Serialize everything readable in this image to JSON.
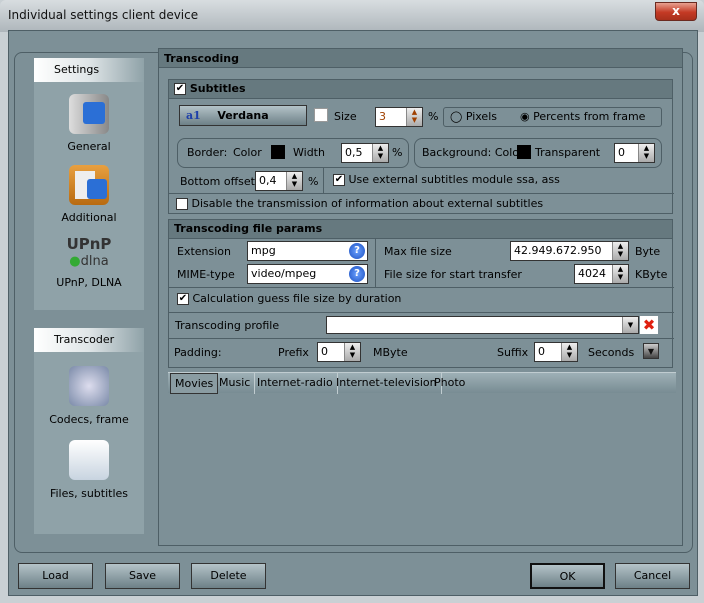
{
  "window": {
    "title": "Individual settings client device",
    "close": "x"
  },
  "sidebar": {
    "settings_header": "Settings",
    "items": [
      {
        "label": "General",
        "icon": "general-device-icon"
      },
      {
        "label": "Additional",
        "icon": "clipboard-checklist-icon"
      },
      {
        "label": "UPnP, DLNA",
        "icon": "upnp-dlna-logo"
      }
    ],
    "transcoder_header": "Transcoder",
    "transcoder_items": [
      {
        "label": "Codecs, frame",
        "icon": "codecs-gears-icon"
      },
      {
        "label": "Files, subtitles",
        "icon": "files-gears-icon"
      }
    ],
    "logo_upnp": "UPnP",
    "logo_dlna": "dlna"
  },
  "main": {
    "title": "Transcoding",
    "subtitles": {
      "label": "Subtitles",
      "checked": true,
      "font_button": "Verdana",
      "font_icon": "a1",
      "size_label": "Size",
      "size_value": "3",
      "size_unit": "%",
      "radio_pixels": "Pixels",
      "radio_percents": "Percents from frame",
      "selected": "Percents from frame",
      "border_label": "Border:",
      "color_label": "Color",
      "width_label": "Width",
      "width_value": "0,5",
      "width_unit": "%",
      "border_color": "#000000",
      "bg_label": "Background: Color",
      "transparent_label": "Transparent",
      "transparent_value": "0",
      "bg_color": "#000000",
      "bottom_offset_label": "Bottom offset",
      "bottom_offset_value": "0,4",
      "bottom_offset_unit": "%",
      "use_external_label": "Use external subtitles module ssa, ass",
      "use_external_checked": true,
      "disable_label": "Disable the transmission of information about external subtitles",
      "disable_checked": false
    },
    "file_params": {
      "label": "Transcoding file params",
      "extension_label": "Extension",
      "extension_value": "mpg",
      "mime_label": "MIME-type",
      "mime_value": "video/mpeg",
      "max_size_label": "Max file size",
      "max_size_value": "42.949.672.950",
      "max_size_unit": "Byte",
      "start_size_label": "File size for start transfer",
      "start_size_value": "4024",
      "start_size_unit": "KByte",
      "calc_label": "Calculation guess file size by duration",
      "calc_checked": true,
      "profile_label": "Transcoding profile",
      "profile_value": "",
      "padding_label": "Padding:",
      "prefix_label": "Prefix",
      "prefix_value": "0",
      "prefix_unit": "MByte",
      "suffix_label": "Suffix",
      "suffix_value": "0",
      "suffix_unit": "Seconds"
    },
    "tabs": [
      "Movies",
      "Music",
      "Internet-radio",
      "Internet-television",
      "Photo"
    ],
    "active_tab": "Movies"
  },
  "footer": {
    "load": "Load",
    "save": "Save",
    "delete": "Delete",
    "ok": "OK",
    "cancel": "Cancel"
  }
}
